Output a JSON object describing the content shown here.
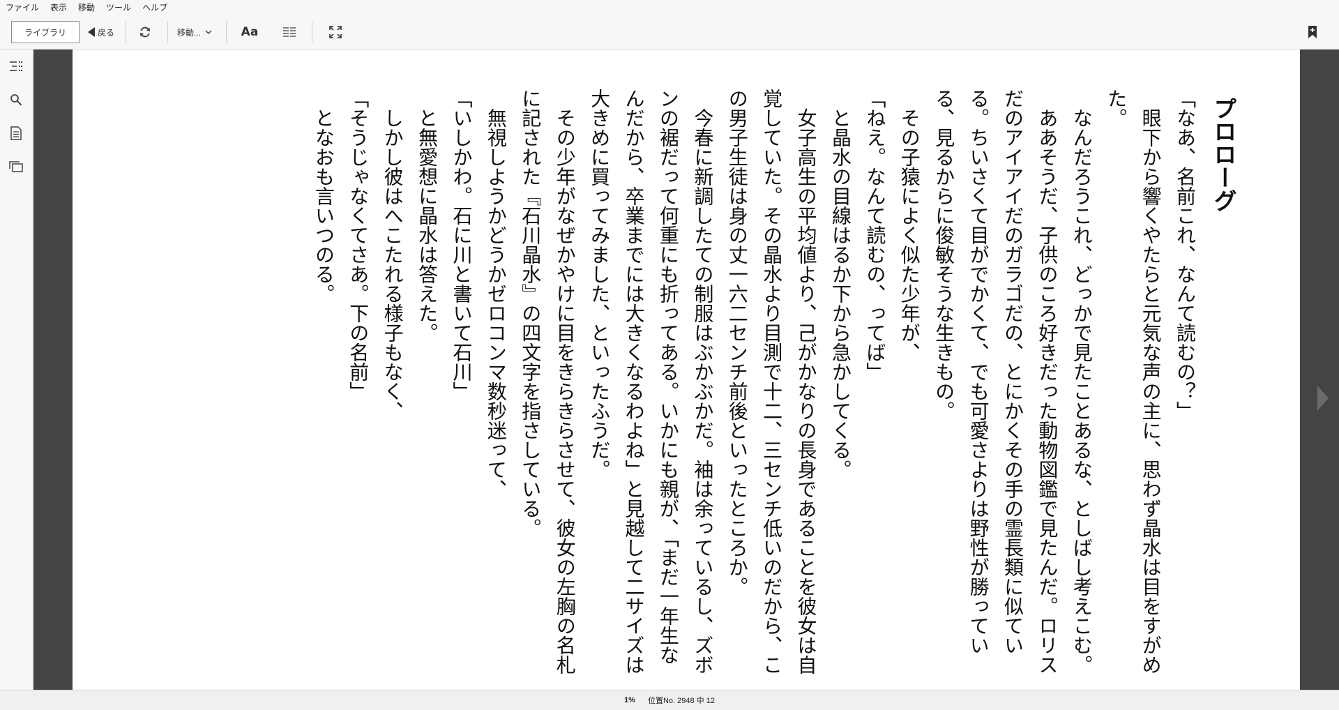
{
  "menu": [
    "ファイル",
    "表示",
    "移動",
    "ツール",
    "ヘルプ"
  ],
  "toolbar": {
    "library_label": "ライブラリ",
    "back_label": "戻る",
    "goto_label": "移動...",
    "font_label": "Aa"
  },
  "book": {
    "chapter_title": "プロローグ",
    "paragraphs": [
      "「なあ、名前これ、なんて読むの？」",
      "　眼下から響くやたらと元気な声の主に、思わず晶水は目をすがめた。",
      "　なんだろうこれ、どっかで見たことあるな、としばし考えこむ。",
      "　ああそうだ、子供のころ好きだった動物図鑑で見たんだ。ロリスだのアイアイだのガラゴだの、とにかくその手の霊長類に似ている。ちいさくて目がでかくて、でも可愛さよりは野性が勝っている、見るからに俊敏そうな生きもの。",
      "　その子猿によく似た少年が、",
      "「ねえ。なんて読むの、ってば」",
      "　と晶水の目線はるか下から急かしてくる。",
      "　女子高生の平均値より、己がかなりの長身であることを彼女は自覚していた。その晶水より目測で十二、三センチ低いのだから、この男子生徒は身の丈一六二センチ前後といったところか。",
      "　今春に新調したての制服はぶかぶかだ。袖は余っているし、ズボンの裾だって何重にも折ってある。いかにも親が、「まだ一年生なんだから、卒業までには大きくなるわよね」と見越して二サイズは大きめに買ってみました、といったふうだ。",
      "　その少年がなぜかやけに目をきらきらさせて、彼女の左胸の名札に記された『石川晶水』の四文字を指さしている。",
      "　無視しようかどうかゼロコンマ数秒迷って、",
      "「いしかわ。石に川と書いて石川」",
      "　と無愛想に晶水は答えた。",
      "　しかし彼はへこたれる様子もなく、",
      "「そうじゃなくてさあ。下の名前」",
      "　となおも言いつのる。"
    ]
  },
  "status": {
    "percent": "1%",
    "location": "位置No. 2948 中 12"
  }
}
